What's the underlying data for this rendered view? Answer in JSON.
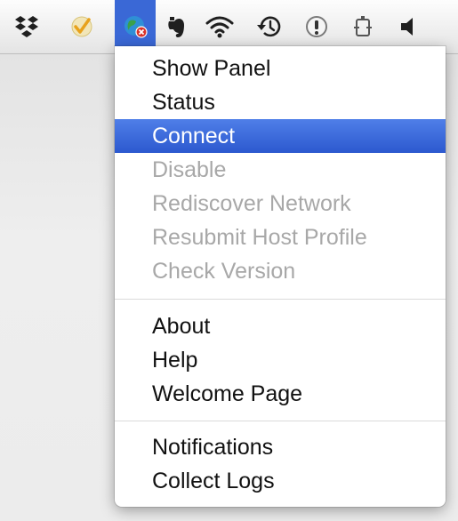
{
  "menubar": {
    "icons": [
      {
        "name": "dropbox-icon"
      },
      {
        "name": "checkmark-shield-icon"
      },
      {
        "name": "globe-network-icon",
        "active": true
      },
      {
        "name": "evernote-elephant-icon"
      },
      {
        "name": "wifi-icon"
      },
      {
        "name": "time-machine-icon"
      },
      {
        "name": "alert-icon"
      },
      {
        "name": "battery-icon"
      },
      {
        "name": "volume-icon"
      }
    ],
    "active_color": "#3a68d6"
  },
  "menu": {
    "items": [
      {
        "label": "Show Panel",
        "state": "enabled"
      },
      {
        "label": "Status",
        "state": "enabled"
      },
      {
        "label": "Connect",
        "state": "highlighted"
      },
      {
        "label": "Disable",
        "state": "disabled"
      },
      {
        "label": "Rediscover Network",
        "state": "disabled"
      },
      {
        "label": "Resubmit Host Profile",
        "state": "disabled"
      },
      {
        "label": "Check Version",
        "state": "disabled"
      },
      {
        "label": "About",
        "state": "enabled"
      },
      {
        "label": "Help",
        "state": "enabled"
      },
      {
        "label": "Welcome Page",
        "state": "enabled"
      },
      {
        "label": "Notifications",
        "state": "enabled"
      },
      {
        "label": "Collect Logs",
        "state": "enabled"
      }
    ],
    "highlight_color": "#3a68d6",
    "disabled_color": "#a8a8a8"
  }
}
